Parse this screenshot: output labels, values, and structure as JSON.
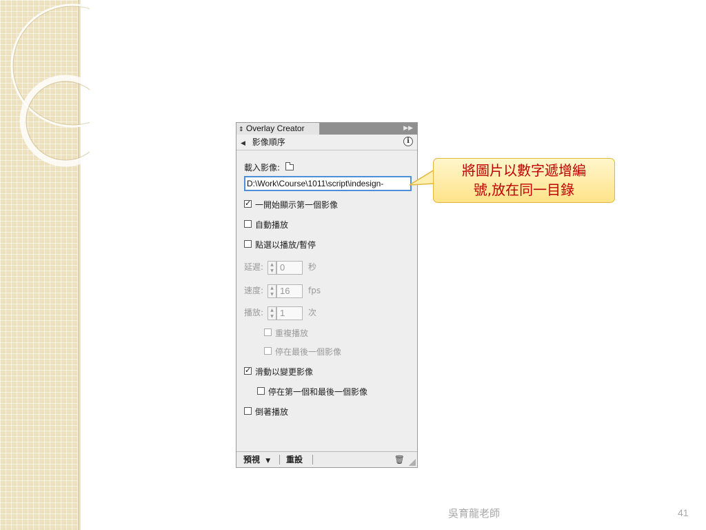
{
  "panel": {
    "tab_title": "Overlay Creator",
    "header_title": "影像順序",
    "load_label": "載入影像:",
    "path_value": "D:\\Work\\Course\\1011\\script\\indesign-",
    "options": {
      "show_first": "一開始顯示第一個影像",
      "autoplay": "自動播放",
      "tap_toggle": "點選以播放/暫停"
    },
    "delay": {
      "label": "延遲:",
      "value": "0",
      "unit": "秒"
    },
    "speed": {
      "label": "速度:",
      "value": "16",
      "unit": "fps"
    },
    "play": {
      "label": "播放:",
      "value": "1",
      "unit": "次"
    },
    "sub_options": {
      "repeat": "重複播放",
      "stop_at_last": "停在最後一個影像"
    },
    "swipe": "滑動以變更影像",
    "stop_first_last": "停在第一個和最後一個影像",
    "reverse": "倒著播放",
    "footer": {
      "preview": "預視",
      "reset": "重設"
    }
  },
  "callout": {
    "line1": "將圖片以數字遞增編",
    "line2": "號,放在同一目錄"
  },
  "footer": {
    "author": "吳育龍老師",
    "page": "41"
  }
}
